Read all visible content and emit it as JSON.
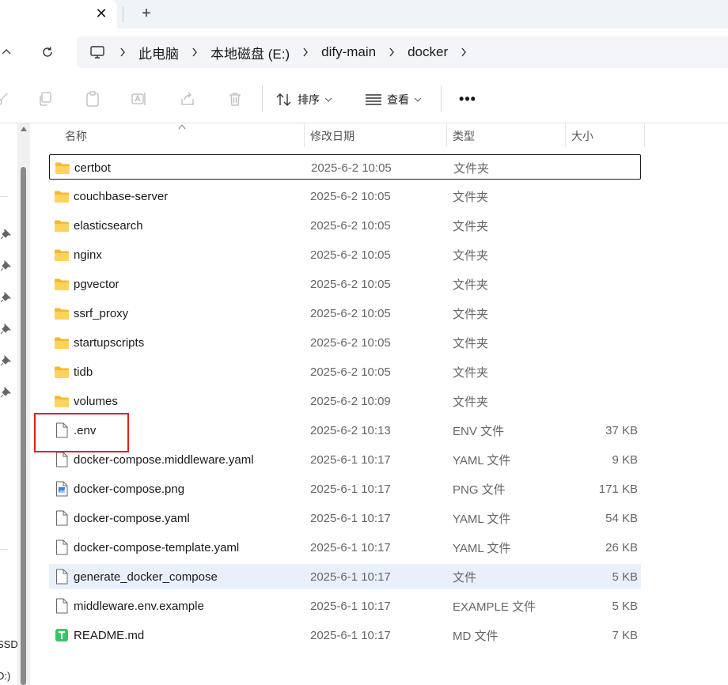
{
  "tab": {
    "close_glyph": "✕",
    "new_glyph": "+"
  },
  "breadcrumb": [
    "此电脑",
    "本地磁盘 (E:)",
    "dify-main",
    "docker"
  ],
  "toolbar": {
    "sort_label": "排序",
    "view_label": "查看",
    "more_label": "•••"
  },
  "columns": {
    "name": "名称",
    "date": "修改日期",
    "type": "类型",
    "size": "大小"
  },
  "nav_fragments": [
    "SSD",
    "D:)"
  ],
  "files": [
    {
      "name": "certbot",
      "date": "2025-6-2 10:05",
      "type": "文件夹",
      "size": "",
      "icon": "folder-icon"
    },
    {
      "name": "couchbase-server",
      "date": "2025-6-2 10:05",
      "type": "文件夹",
      "size": "",
      "icon": "folder-icon"
    },
    {
      "name": "elasticsearch",
      "date": "2025-6-2 10:05",
      "type": "文件夹",
      "size": "",
      "icon": "folder-icon"
    },
    {
      "name": "nginx",
      "date": "2025-6-2 10:05",
      "type": "文件夹",
      "size": "",
      "icon": "folder-icon"
    },
    {
      "name": "pgvector",
      "date": "2025-6-2 10:05",
      "type": "文件夹",
      "size": "",
      "icon": "folder-icon"
    },
    {
      "name": "ssrf_proxy",
      "date": "2025-6-2 10:05",
      "type": "文件夹",
      "size": "",
      "icon": "folder-icon"
    },
    {
      "name": "startupscripts",
      "date": "2025-6-2 10:05",
      "type": "文件夹",
      "size": "",
      "icon": "folder-icon"
    },
    {
      "name": "tidb",
      "date": "2025-6-2 10:05",
      "type": "文件夹",
      "size": "",
      "icon": "folder-icon"
    },
    {
      "name": "volumes",
      "date": "2025-6-2 10:09",
      "type": "文件夹",
      "size": "",
      "icon": "folder-icon"
    },
    {
      "name": ".env",
      "date": "2025-6-2 10:13",
      "type": "ENV 文件",
      "size": "37 KB",
      "icon": "file-icon"
    },
    {
      "name": "docker-compose.middleware.yaml",
      "date": "2025-6-1 10:17",
      "type": "YAML 文件",
      "size": "9 KB",
      "icon": "file-icon"
    },
    {
      "name": "docker-compose.png",
      "date": "2025-6-1 10:17",
      "type": "PNG 文件",
      "size": "171 KB",
      "icon": "image-file-icon"
    },
    {
      "name": "docker-compose.yaml",
      "date": "2025-6-1 10:17",
      "type": "YAML 文件",
      "size": "54 KB",
      "icon": "file-icon"
    },
    {
      "name": "docker-compose-template.yaml",
      "date": "2025-6-1 10:17",
      "type": "YAML 文件",
      "size": "26 KB",
      "icon": "file-icon"
    },
    {
      "name": "generate_docker_compose",
      "date": "2025-6-1 10:17",
      "type": "文件",
      "size": "5 KB",
      "icon": "file-icon"
    },
    {
      "name": "middleware.env.example",
      "date": "2025-6-1 10:17",
      "type": "EXAMPLE 文件",
      "size": "5 KB",
      "icon": "file-icon"
    },
    {
      "name": "README.md",
      "date": "2025-6-1 10:17",
      "type": "MD 文件",
      "size": "7 KB",
      "icon": "markdown-file-icon"
    }
  ],
  "colors": {
    "accent_highlight": "#e02020",
    "hover_row": "#e8f1fb",
    "folder": "#f7c948"
  }
}
